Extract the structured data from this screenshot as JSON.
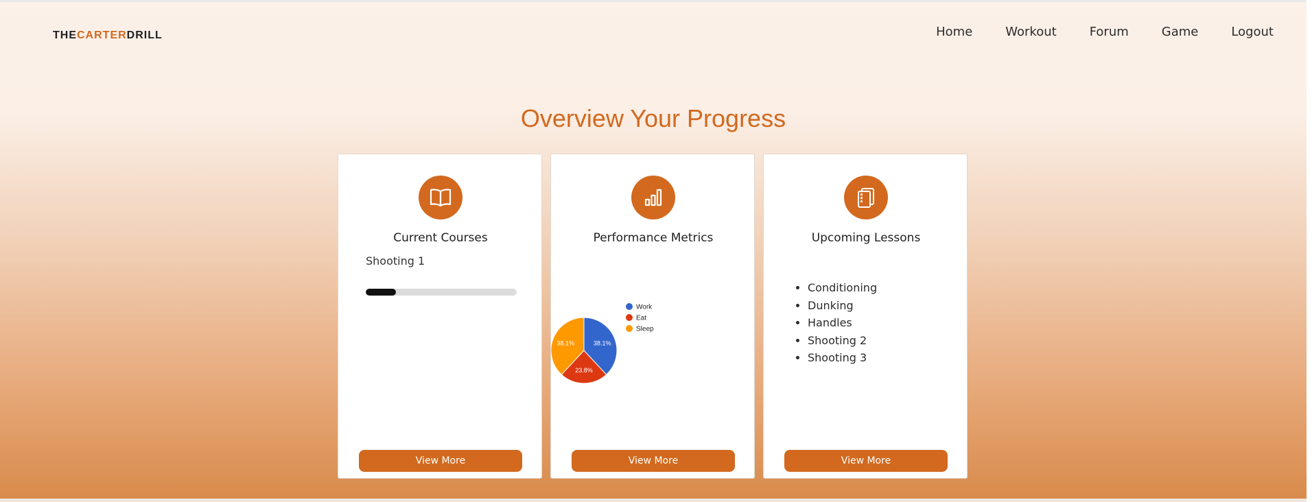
{
  "brand": {
    "part1": "THE",
    "part2": "CARTER",
    "part3": "DRILL"
  },
  "nav": {
    "items": [
      "Home",
      "Workout",
      "Forum",
      "Game",
      "Logout"
    ]
  },
  "page": {
    "title": "Overview Your Progress"
  },
  "cards": {
    "current_courses": {
      "title": "Current Courses",
      "course": "Shooting 1",
      "progress_fraction": 0.2,
      "button": "View More",
      "icon": "book-icon"
    },
    "performance_metrics": {
      "title": "Performance Metrics",
      "button": "View More",
      "icon": "bar-chart-icon"
    },
    "upcoming_lessons": {
      "title": "Upcoming Lessons",
      "items": [
        "Conditioning",
        "Dunking",
        "Handles",
        "Shooting 2",
        "Shooting 3"
      ],
      "button": "View More",
      "icon": "notebook-icon"
    }
  },
  "colors": {
    "accent": "#d2691e",
    "work": "#3366cc",
    "eat": "#dc3912",
    "sleep": "#ff9900"
  },
  "chart_data": {
    "type": "pie",
    "categories": [
      "Work",
      "Eat",
      "Sleep"
    ],
    "values": [
      38.1,
      23.8,
      38.1
    ],
    "labels": [
      "38.1%",
      "23.8%",
      "38.1%"
    ],
    "colors": [
      "#3366cc",
      "#dc3912",
      "#ff9900"
    ],
    "legend_position": "right"
  }
}
